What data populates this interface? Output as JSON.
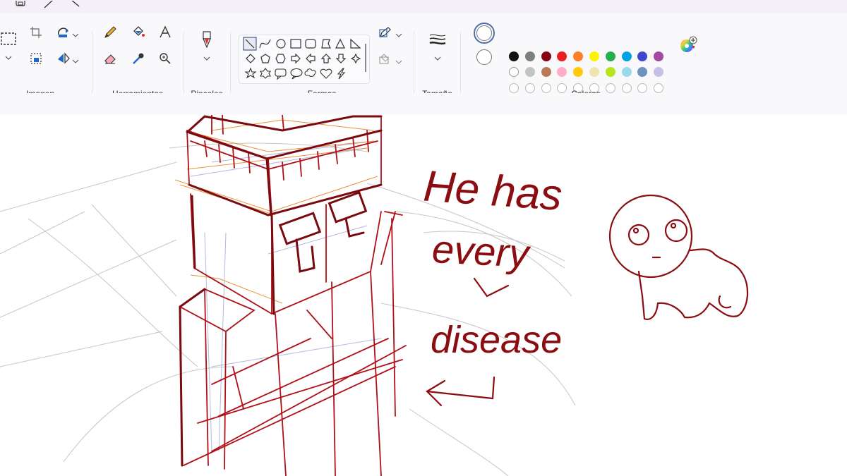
{
  "ribbon": {
    "groups": [
      {
        "id": "imagen",
        "label": "Imagen"
      },
      {
        "id": "herramientas",
        "label": "Herramientas"
      },
      {
        "id": "pinceles",
        "label": "Pinceles"
      },
      {
        "id": "formas",
        "label": "Formas"
      },
      {
        "id": "tamano",
        "label": "Tamaño"
      },
      {
        "id": "colores",
        "label": "Colores"
      }
    ],
    "colors": {
      "row1": [
        "#111111",
        "#7f7f7f",
        "#880015",
        "#ed1c24",
        "#ff7f27",
        "#fff200",
        "#22b14c",
        "#00a2e8",
        "#3f48cc",
        "#a349a4"
      ],
      "row2": [
        "#ffffff",
        "#c3c3c3",
        "#b97a57",
        "#ffaec9",
        "#ffc90e",
        "#efe4b0",
        "#b5e61d",
        "#99d9ea",
        "#7092be",
        "#c8bfe7"
      ],
      "primary_color": "#ffffff",
      "secondary_color": "#ffffff"
    },
    "shapes": [
      "line",
      "curve",
      "oval",
      "rectangle",
      "rounded-rectangle",
      "polygon",
      "triangle",
      "right-triangle",
      "diamond",
      "pentagon",
      "hexagon",
      "right-arrow",
      "left-arrow",
      "up-arrow",
      "down-arrow",
      "four-point-star",
      "five-point-star",
      "six-point-star",
      "rounded-callout",
      "oval-callout",
      "cloud-callout",
      "heart",
      "lightning"
    ]
  },
  "canvas": {
    "handwriting": {
      "line1": "He has",
      "line2": "every",
      "line3": "disease"
    },
    "ink_color": "#8b0d12"
  }
}
